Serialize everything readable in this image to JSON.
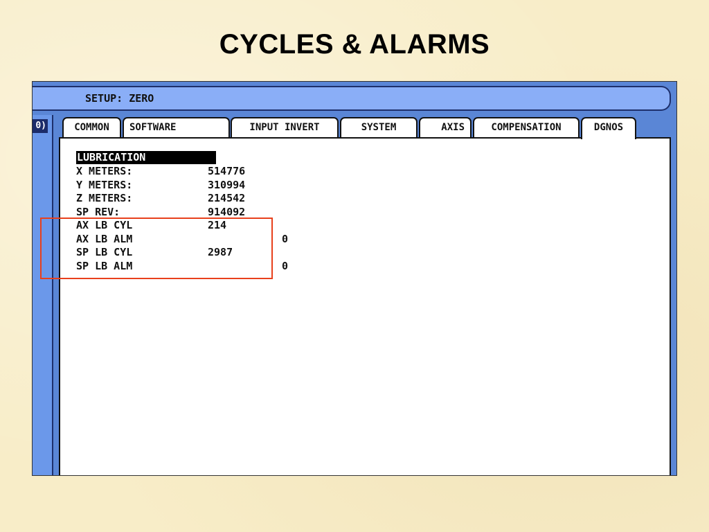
{
  "slide": {
    "title": "CYCLES & ALARMS"
  },
  "screen": {
    "setup_label": "SETUP: ZERO",
    "side_label": "0)",
    "tabs": [
      {
        "label": "COMMON"
      },
      {
        "label": "SOFTWARE"
      },
      {
        "label": "INPUT INVERT"
      },
      {
        "label": "SYSTEM"
      },
      {
        "label": "AXIS"
      },
      {
        "label": "COMPENSATION"
      },
      {
        "label": "DGNOS",
        "active": true
      }
    ],
    "section_heading": "LUBRICATION",
    "rows": [
      {
        "label": "X METERS:",
        "value": "514776"
      },
      {
        "label": "Y METERS:",
        "value": "310994"
      },
      {
        "label": "Z METERS:",
        "value": "214542"
      },
      {
        "label": "SP REV:",
        "value": "914092"
      },
      {
        "label": "AX LB CYL",
        "value": "214"
      },
      {
        "label": "AX LB ALM",
        "value": "0"
      },
      {
        "label": "SP LB CYL",
        "value": "2987"
      },
      {
        "label": "SP LB ALM",
        "value": "0"
      }
    ]
  },
  "colors": {
    "background": "#f8edc8",
    "screen_blue": "#5a86d6",
    "setup_bar": "#8aaef7",
    "highlight": "#e8401c"
  }
}
